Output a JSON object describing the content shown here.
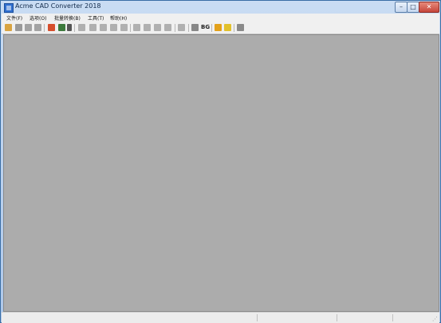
{
  "window": {
    "title": "Acme CAD Converter 2018",
    "controls": {
      "minimize": "–",
      "maximize": "□",
      "close": "✕"
    }
  },
  "menu": {
    "items": [
      "文件(F)",
      "选项(O)",
      "批量转换(B)",
      "工具(T)",
      "帮助(H)"
    ]
  },
  "toolbar": {
    "buttons": [
      {
        "icon": "open-folder-icon",
        "color": "#d9a441"
      },
      {
        "icon": "save-icon",
        "color": "#9a9a9a"
      },
      {
        "icon": "print-icon",
        "color": "#a3a3a3"
      },
      {
        "icon": "print-preview-icon",
        "color": "#a3a3a3"
      },
      {
        "icon": "convert-icon",
        "color": "#d64e2c"
      },
      {
        "icon": "layers-icon",
        "color": "#3c7a3c"
      },
      {
        "icon": "dropdown-arrow-icon",
        "color": "#555555"
      },
      {
        "icon": "pan-icon",
        "color": "#b0b0b0"
      },
      {
        "icon": "zoom-window-icon",
        "color": "#b0b0b0"
      },
      {
        "icon": "zoom-in-icon",
        "color": "#b0b0b0"
      },
      {
        "icon": "zoom-out-icon",
        "color": "#b0b0b0"
      },
      {
        "icon": "zoom-realtime-icon",
        "color": "#b0b0b0"
      },
      {
        "icon": "zoom-extents-icon",
        "color": "#b0b0b0"
      },
      {
        "icon": "zoom-previous-icon",
        "color": "#b0b0b0"
      },
      {
        "icon": "view-icon",
        "color": "#b0b0b0"
      },
      {
        "icon": "measure-icon",
        "color": "#b0b0b0"
      },
      {
        "icon": "layout-icon",
        "color": "#b0b0b0"
      },
      {
        "icon": "bg-color-icon",
        "color": "#888888"
      },
      {
        "icon": "background-text-icon",
        "label": "BG",
        "color": "#222222"
      },
      {
        "icon": "warning-icon",
        "color": "#e3a11a"
      },
      {
        "icon": "frame-icon",
        "color": "#e2c12c"
      },
      {
        "icon": "info-icon",
        "color": "#8a8a8a"
      }
    ]
  },
  "canvas": {
    "color": "#acacac"
  }
}
